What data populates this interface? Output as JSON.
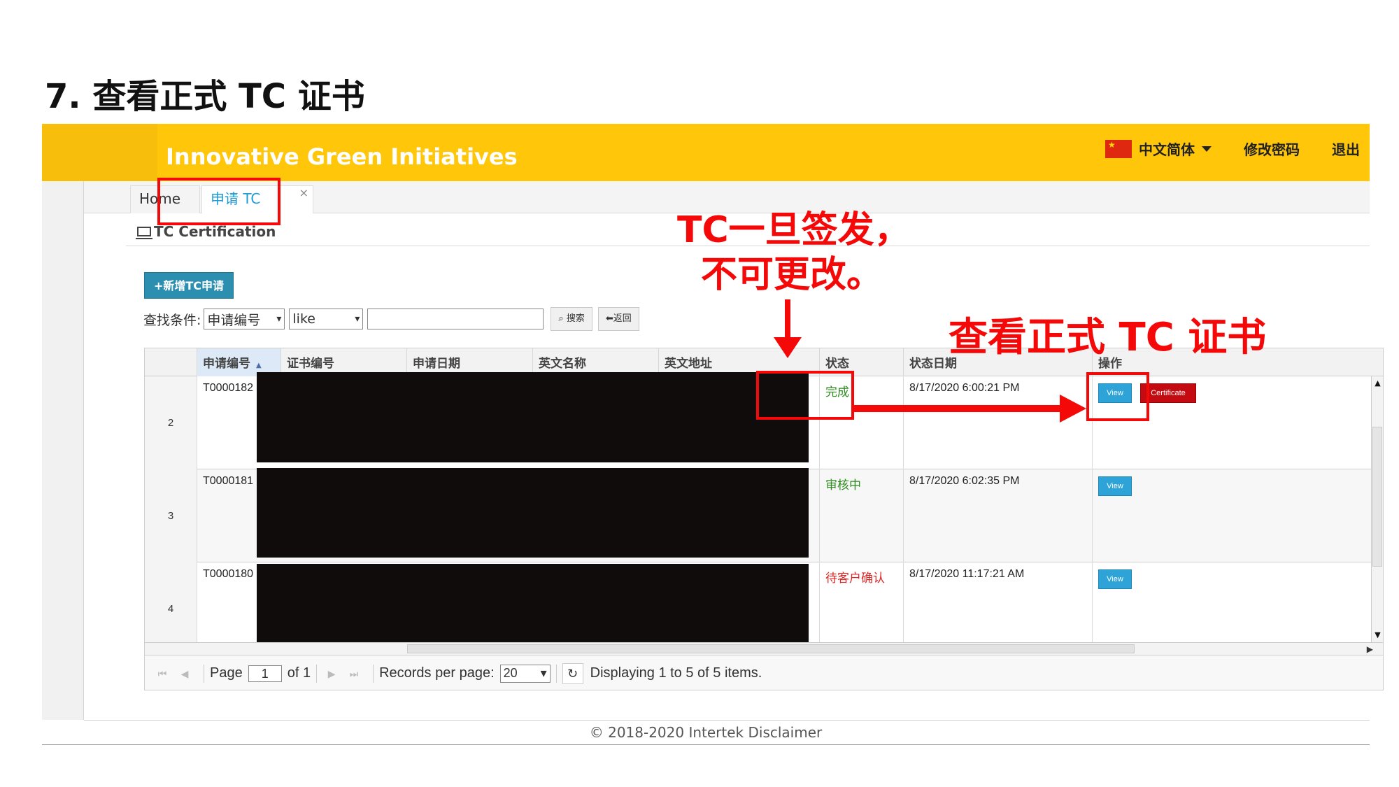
{
  "slide": {
    "title": "7. 查看正式 TC 证书"
  },
  "header": {
    "app_title": "Innovative Green Initiatives",
    "language": "中文简体",
    "change_password": "修改密码",
    "logout": "退出"
  },
  "tabs": [
    {
      "label": "Home"
    },
    {
      "label": "申请 TC",
      "close": "×"
    }
  ],
  "panel": {
    "title": "TC Certification",
    "add_button": "+新增TC申请"
  },
  "search": {
    "label": "查找条件:",
    "field": "申请编号",
    "operator": "like",
    "value": "",
    "search_button": "⌕ 搜索",
    "back_button": "⬅返回"
  },
  "grid": {
    "columns": [
      "申请编号",
      "证书编号",
      "申请日期",
      "英文名称",
      "英文地址",
      "状态",
      "状态日期",
      "操作"
    ],
    "rows": [
      {
        "num": "2",
        "app_no": "T0000182",
        "status": "完成",
        "status_color": "#2e8b1e",
        "status_date": "8/17/2020 6:00:21 PM",
        "view": "View",
        "certificate": "Certificate"
      },
      {
        "num": "3",
        "app_no": "T0000181",
        "status": "审核中",
        "status_color": "#2e8b1e",
        "status_date": "8/17/2020 6:02:35 PM",
        "view": "View"
      },
      {
        "num": "4",
        "app_no": "T0000180",
        "status": "待客户确认",
        "status_color": "#e02424",
        "status_date": "8/17/2020 11:17:21 AM",
        "view": "View"
      }
    ]
  },
  "pager": {
    "page_label": "Page",
    "page": "1",
    "of_label": "of 1",
    "records_label": "Records per page:",
    "per_page": "20",
    "display": "Displaying 1 to 5 of 5 items."
  },
  "footer": {
    "text": "© 2018-2020 Intertek Disclaimer"
  },
  "annotations": {
    "note_line1": "TC一旦签发，",
    "note_line2": "不可更改。",
    "view_cert": "查看正式 TC 证书",
    "color": "#f40808"
  }
}
